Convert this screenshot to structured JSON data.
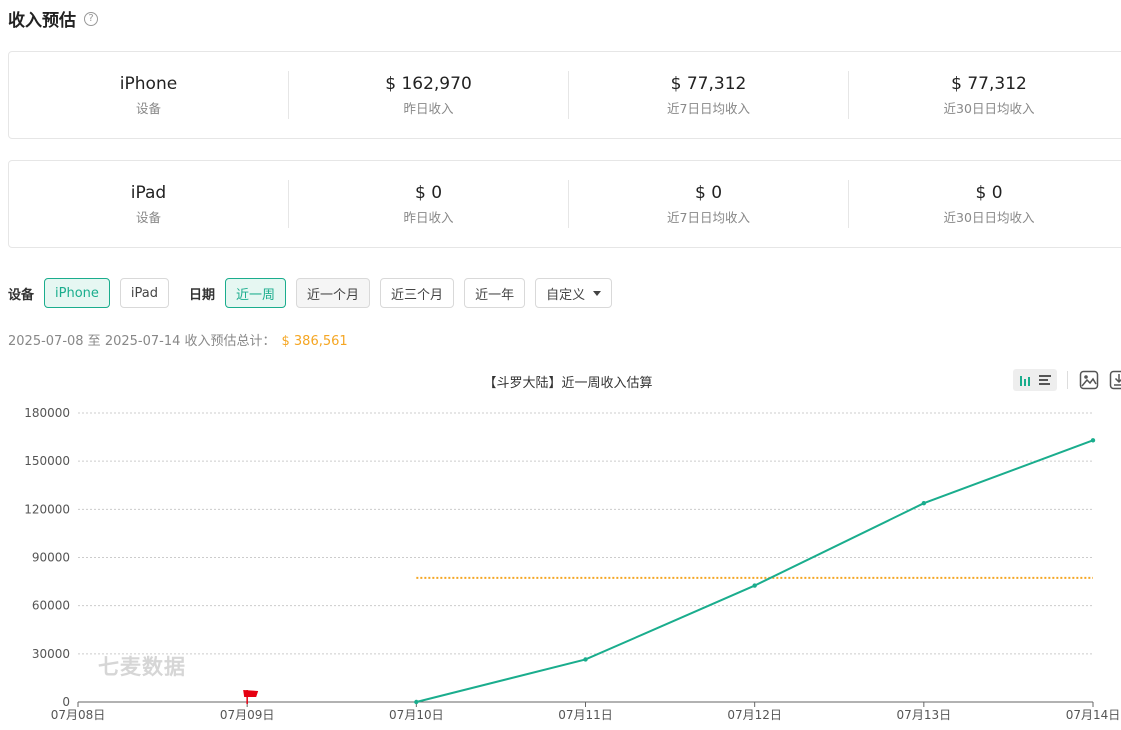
{
  "header": {
    "title": "收入预估",
    "help_icon": "question-circle-icon"
  },
  "cards": [
    {
      "device": "iPhone",
      "device_label": "设备",
      "yesterday": "$ 162,970",
      "yesterday_label": "昨日收入",
      "avg7": "$ 77,312",
      "avg7_label": "近7日日均收入",
      "avg30": "$ 77,312",
      "avg30_label": "近30日日均收入"
    },
    {
      "device": "iPad",
      "device_label": "设备",
      "yesterday": "$ 0",
      "yesterday_label": "昨日收入",
      "avg7": "$ 0",
      "avg7_label": "近7日日均收入",
      "avg30": "$ 0",
      "avg30_label": "近30日日均收入"
    }
  ],
  "filters": {
    "device_label": "设备",
    "devices": [
      "iPhone",
      "iPad"
    ],
    "date_label": "日期",
    "ranges": [
      "近一周",
      "近一个月",
      "近三个月",
      "近一年"
    ],
    "custom": "自定义"
  },
  "summary": {
    "text": "2025-07-08 至 2025-07-14 收入预估总计：",
    "total": "$ 386,561"
  },
  "watermark": "七麦数据",
  "toolbar": {
    "icons": [
      "bar-chart-icon",
      "list-icon",
      "image-download-icon",
      "download-icon"
    ]
  },
  "colors": {
    "accent": "#1aad8d",
    "line": "#1aad8d",
    "average": "#f5a623",
    "flag": "#e60012"
  },
  "chart_data": {
    "type": "line",
    "title": "【斗罗大陆】近一周收入估算",
    "categories": [
      "07月08日",
      "07月09日",
      "07月10日",
      "07月11日",
      "07月12日",
      "07月13日",
      "07月14日"
    ],
    "series": [
      {
        "values": [
          null,
          null,
          0,
          26500,
          72500,
          123800,
          162970
        ]
      }
    ],
    "average_line": {
      "value": 77312,
      "from_index": 2,
      "to_index": 6
    },
    "marker": {
      "type": "flag",
      "category_index": 1
    },
    "ylim": [
      0,
      180000
    ],
    "yticks": [
      0,
      30000,
      60000,
      90000,
      120000,
      150000,
      180000
    ],
    "grid": true
  }
}
